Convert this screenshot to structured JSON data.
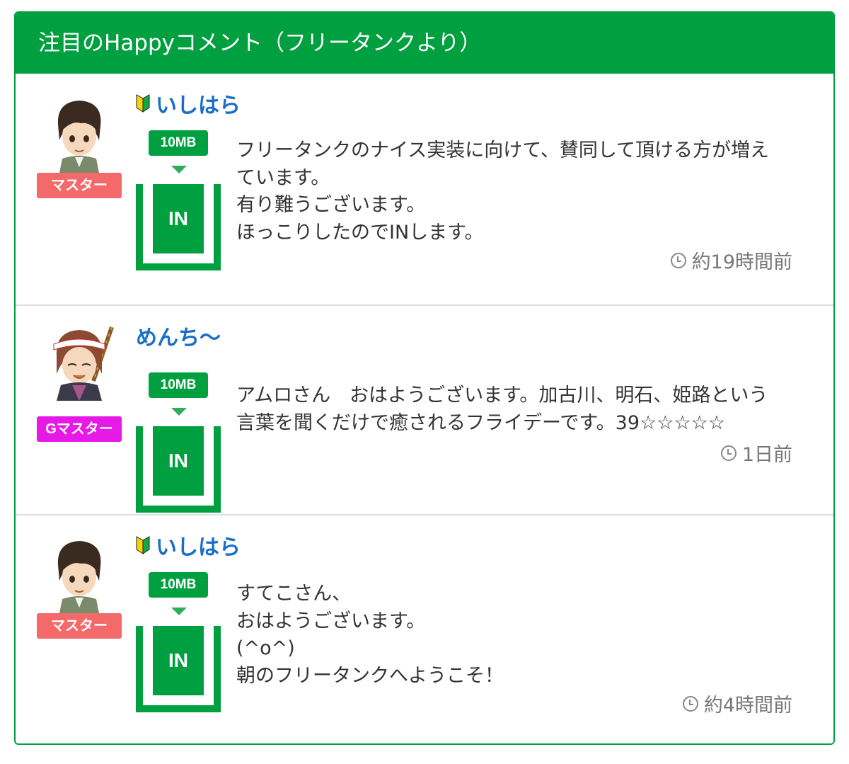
{
  "header": {
    "title": "注目のHappyコメント（フリータンクより）"
  },
  "colors": {
    "brand_green": "#00a040",
    "name_blue": "#1a6ec7",
    "master_badge": "#f46a6a",
    "gmaster_badge": "#e619e6"
  },
  "entries": [
    {
      "rank": "マスター",
      "rank_color": "#f46a6a",
      "user": "いしはら",
      "beginner_icon": true,
      "size_tag": "10MB",
      "in_label": "IN",
      "comment_lines": [
        "フリータンクのナイス実装に向けて、賛同して頂ける方が増え",
        "ています。",
        "有り難うございます。",
        "ほっこりしたのでINします。"
      ],
      "time": "約19時間前"
    },
    {
      "rank": "Gマスター",
      "rank_color": "#e619e6",
      "user": "めんち〜",
      "beginner_icon": false,
      "size_tag": "10MB",
      "in_label": "IN",
      "comment_lines": [
        "アムロさん　おはようございます。加古川、明石、姫路という",
        "言葉を聞くだけで癒されるフライデーです。39☆☆☆☆☆"
      ],
      "time": "1日前"
    },
    {
      "rank": "マスター",
      "rank_color": "#f46a6a",
      "user": "いしはら",
      "beginner_icon": true,
      "size_tag": "10MB",
      "in_label": "IN",
      "comment_lines": [
        "すてこさん、",
        "おはようございます。",
        "(^o^)",
        "朝のフリータンクへようこそ！"
      ],
      "time": "約4時間前"
    }
  ]
}
